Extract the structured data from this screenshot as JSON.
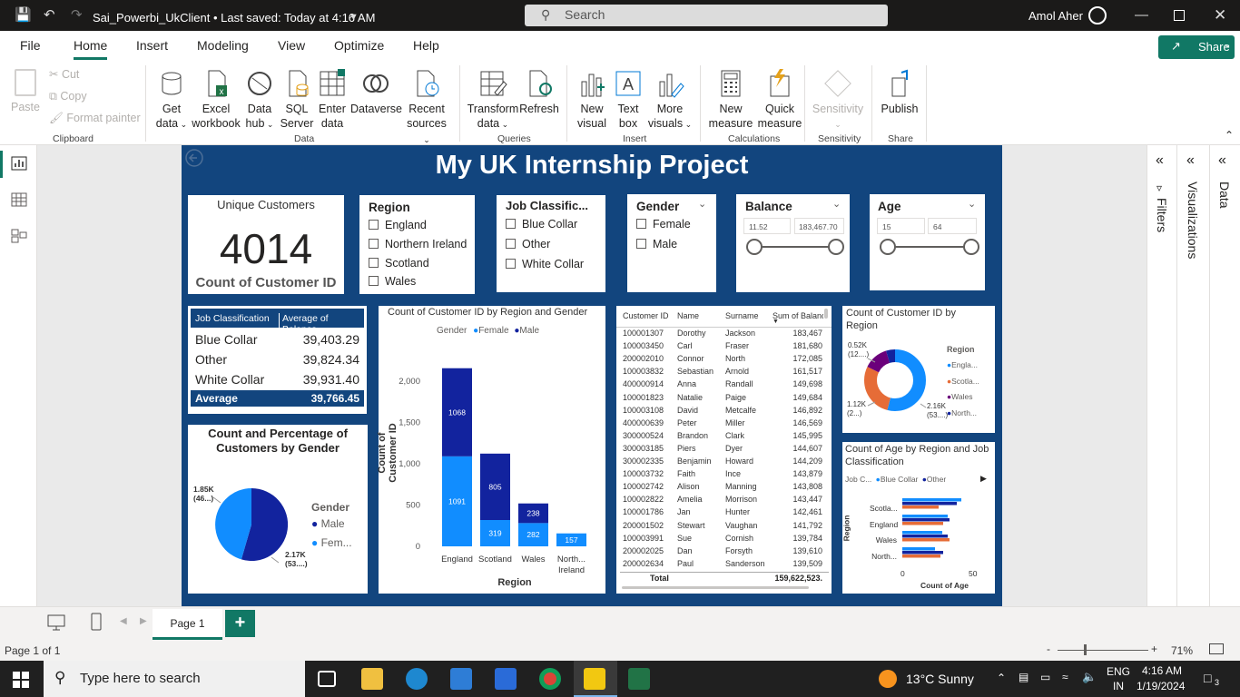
{
  "titlebar": {
    "doc_title": "Sai_Powerbi_UkClient • Last saved: Today at 4:16 AM",
    "search_placeholder": "Search",
    "user_name": "Amol Aher"
  },
  "menu": {
    "items": [
      "File",
      "Home",
      "Insert",
      "Modeling",
      "View",
      "Optimize",
      "Help"
    ],
    "share_label": "Share"
  },
  "ribbon": {
    "clipboard": {
      "paste": "Paste",
      "cut": "Cut",
      "copy": "Copy",
      "format_painter": "Format painter",
      "group": "Clipboard"
    },
    "data": {
      "get_data": "Get",
      "get_data2": "data",
      "excel": "Excel",
      "excel2": "workbook",
      "hub": "Data",
      "hub2": "hub",
      "sql": "SQL",
      "sql2": "Server",
      "enter": "Enter",
      "enter2": "data",
      "dataverse": "Dataverse",
      "recent": "Recent",
      "recent2": "sources",
      "group": "Data"
    },
    "queries": {
      "transform": "Transform",
      "transform2": "data",
      "refresh": "Refresh",
      "group": "Queries"
    },
    "insert": {
      "new_visual": "New",
      "new_visual2": "visual",
      "text_box": "Text",
      "text_box2": "box",
      "more_visuals": "More",
      "more_visuals2": "visuals",
      "group": "Insert"
    },
    "calculations": {
      "new_measure": "New",
      "new_measure2": "measure",
      "quick_measure": "Quick",
      "quick_measure2": "measure",
      "group": "Calculations"
    },
    "sensitivity": {
      "label": "Sensitivity",
      "group": "Sensitivity"
    },
    "share": {
      "publish": "Publish",
      "group": "Share"
    }
  },
  "report": {
    "title": "My UK Internship Project",
    "kpi": {
      "title": "Unique Customers",
      "value": "4014",
      "subtitle": "Count of Customer ID"
    },
    "region_slicer": {
      "title": "Region",
      "items": [
        "England",
        "Northern Ireland",
        "Scotland",
        "Wales"
      ]
    },
    "job_slicer": {
      "title": "Job Classific...",
      "items": [
        "Blue Collar",
        "Other",
        "White Collar"
      ]
    },
    "gender_slicer": {
      "title": "Gender",
      "items": [
        "Female",
        "Male"
      ]
    },
    "balance_slicer": {
      "title": "Balance",
      "min": "11.52",
      "max": "183,467.70"
    },
    "age_slicer": {
      "title": "Age",
      "min": "15",
      "max": "64"
    },
    "job_table": {
      "headers": [
        "Job Classification",
        "Average of Balance"
      ],
      "rows": [
        [
          "Blue Collar",
          "39,403.29"
        ],
        [
          "Other",
          "39,824.34"
        ],
        [
          "White Collar",
          "39,931.40"
        ]
      ],
      "total": [
        "Average",
        "39,766.45"
      ]
    },
    "gender_pie": {
      "title": "Count and Percentage of Customers by Gender",
      "legend_title": "Gender",
      "legend": [
        "Male",
        "Fem..."
      ],
      "label_female": "1.85K",
      "label_female2": "(46...)",
      "label_male": "2.17K",
      "label_male2": "(53....)"
    },
    "detail_table": {
      "headers": [
        "Customer ID",
        "Name",
        "Surname",
        "Sum of Balance"
      ],
      "rows": [
        [
          "100001307",
          "Dorothy",
          "Jackson",
          "183,467"
        ],
        [
          "100003450",
          "Carl",
          "Fraser",
          "181,680"
        ],
        [
          "200002010",
          "Connor",
          "North",
          "172,085"
        ],
        [
          "100003832",
          "Sebastian",
          "Arnold",
          "161,517"
        ],
        [
          "400000914",
          "Anna",
          "Randall",
          "149,698"
        ],
        [
          "100001823",
          "Natalie",
          "Paige",
          "149,684"
        ],
        [
          "100003108",
          "David",
          "Metcalfe",
          "146,892"
        ],
        [
          "400000639",
          "Peter",
          "Miller",
          "146,569"
        ],
        [
          "300000524",
          "Brandon",
          "Clark",
          "145,995"
        ],
        [
          "300003185",
          "Piers",
          "Dyer",
          "144,607"
        ],
        [
          "300002335",
          "Benjamin",
          "Howard",
          "144,209"
        ],
        [
          "100003732",
          "Faith",
          "Ince",
          "143,879"
        ],
        [
          "100002742",
          "Alison",
          "Manning",
          "143,808"
        ],
        [
          "100002822",
          "Amelia",
          "Morrison",
          "143,447"
        ],
        [
          "100001786",
          "Jan",
          "Hunter",
          "142,461"
        ],
        [
          "200001502",
          "Stewart",
          "Vaughan",
          "141,792"
        ],
        [
          "100003991",
          "Sue",
          "Cornish",
          "139,784"
        ],
        [
          "200002025",
          "Dan",
          "Forsyth",
          "139,610"
        ],
        [
          "200002634",
          "Paul",
          "Sanderson",
          "139,509"
        ]
      ],
      "total_label": "Total",
      "total_value": "159,622,523."
    },
    "donut": {
      "title": "Count of Customer ID by Region",
      "legend_title": "Region",
      "legend": [
        "Engla...",
        "Scotla...",
        "Wales",
        "North..."
      ],
      "label_top": "0.52K",
      "label_top2": "(12....)",
      "label_left": "1.12K",
      "label_left2": "(2...)",
      "label_right": "2.16K",
      "label_right2": "(53....)"
    },
    "age_bar": {
      "title": "Count of Age by Region and Job Classification",
      "legend_title": "Job C...",
      "legend": [
        "Blue Collar",
        "Other"
      ],
      "ylabel": "Region",
      "xlabel": "Count of Age",
      "ticks": [
        "0",
        "50"
      ]
    }
  },
  "chart_data": {
    "type": "bar",
    "title": "Count of Customer ID by Region and Gender",
    "legend_title": "Gender",
    "categories": [
      "England",
      "Scotland",
      "Wales",
      "North... Ireland"
    ],
    "series": [
      {
        "name": "Female",
        "values": [
          1091,
          319,
          282,
          157
        ]
      },
      {
        "name": "Male",
        "values": [
          1068,
          805,
          238,
          0
        ]
      }
    ],
    "stacked": true,
    "xlabel": "Region",
    "ylabel": "Count of Customer ID",
    "yticks": [
      "0",
      "500",
      "1,000",
      "1,500",
      "2,000"
    ],
    "ylim": [
      0,
      2200
    ],
    "colors": {
      "Female": "#118dff",
      "Male": "#12239e"
    }
  },
  "rightpanes": {
    "filters": "Filters",
    "visualizations": "Visualizations",
    "data": "Data"
  },
  "pagebar": {
    "page_tab": "Page 1"
  },
  "statusbar": {
    "page_info": "Page 1 of 1",
    "zoom": "71%"
  },
  "taskbar": {
    "search_placeholder": "Type here to search",
    "weather": "13°C  Sunny",
    "lang1": "ENG",
    "lang2": "IN",
    "time": "4:16 AM",
    "date": "1/19/2024",
    "notif": "3"
  }
}
